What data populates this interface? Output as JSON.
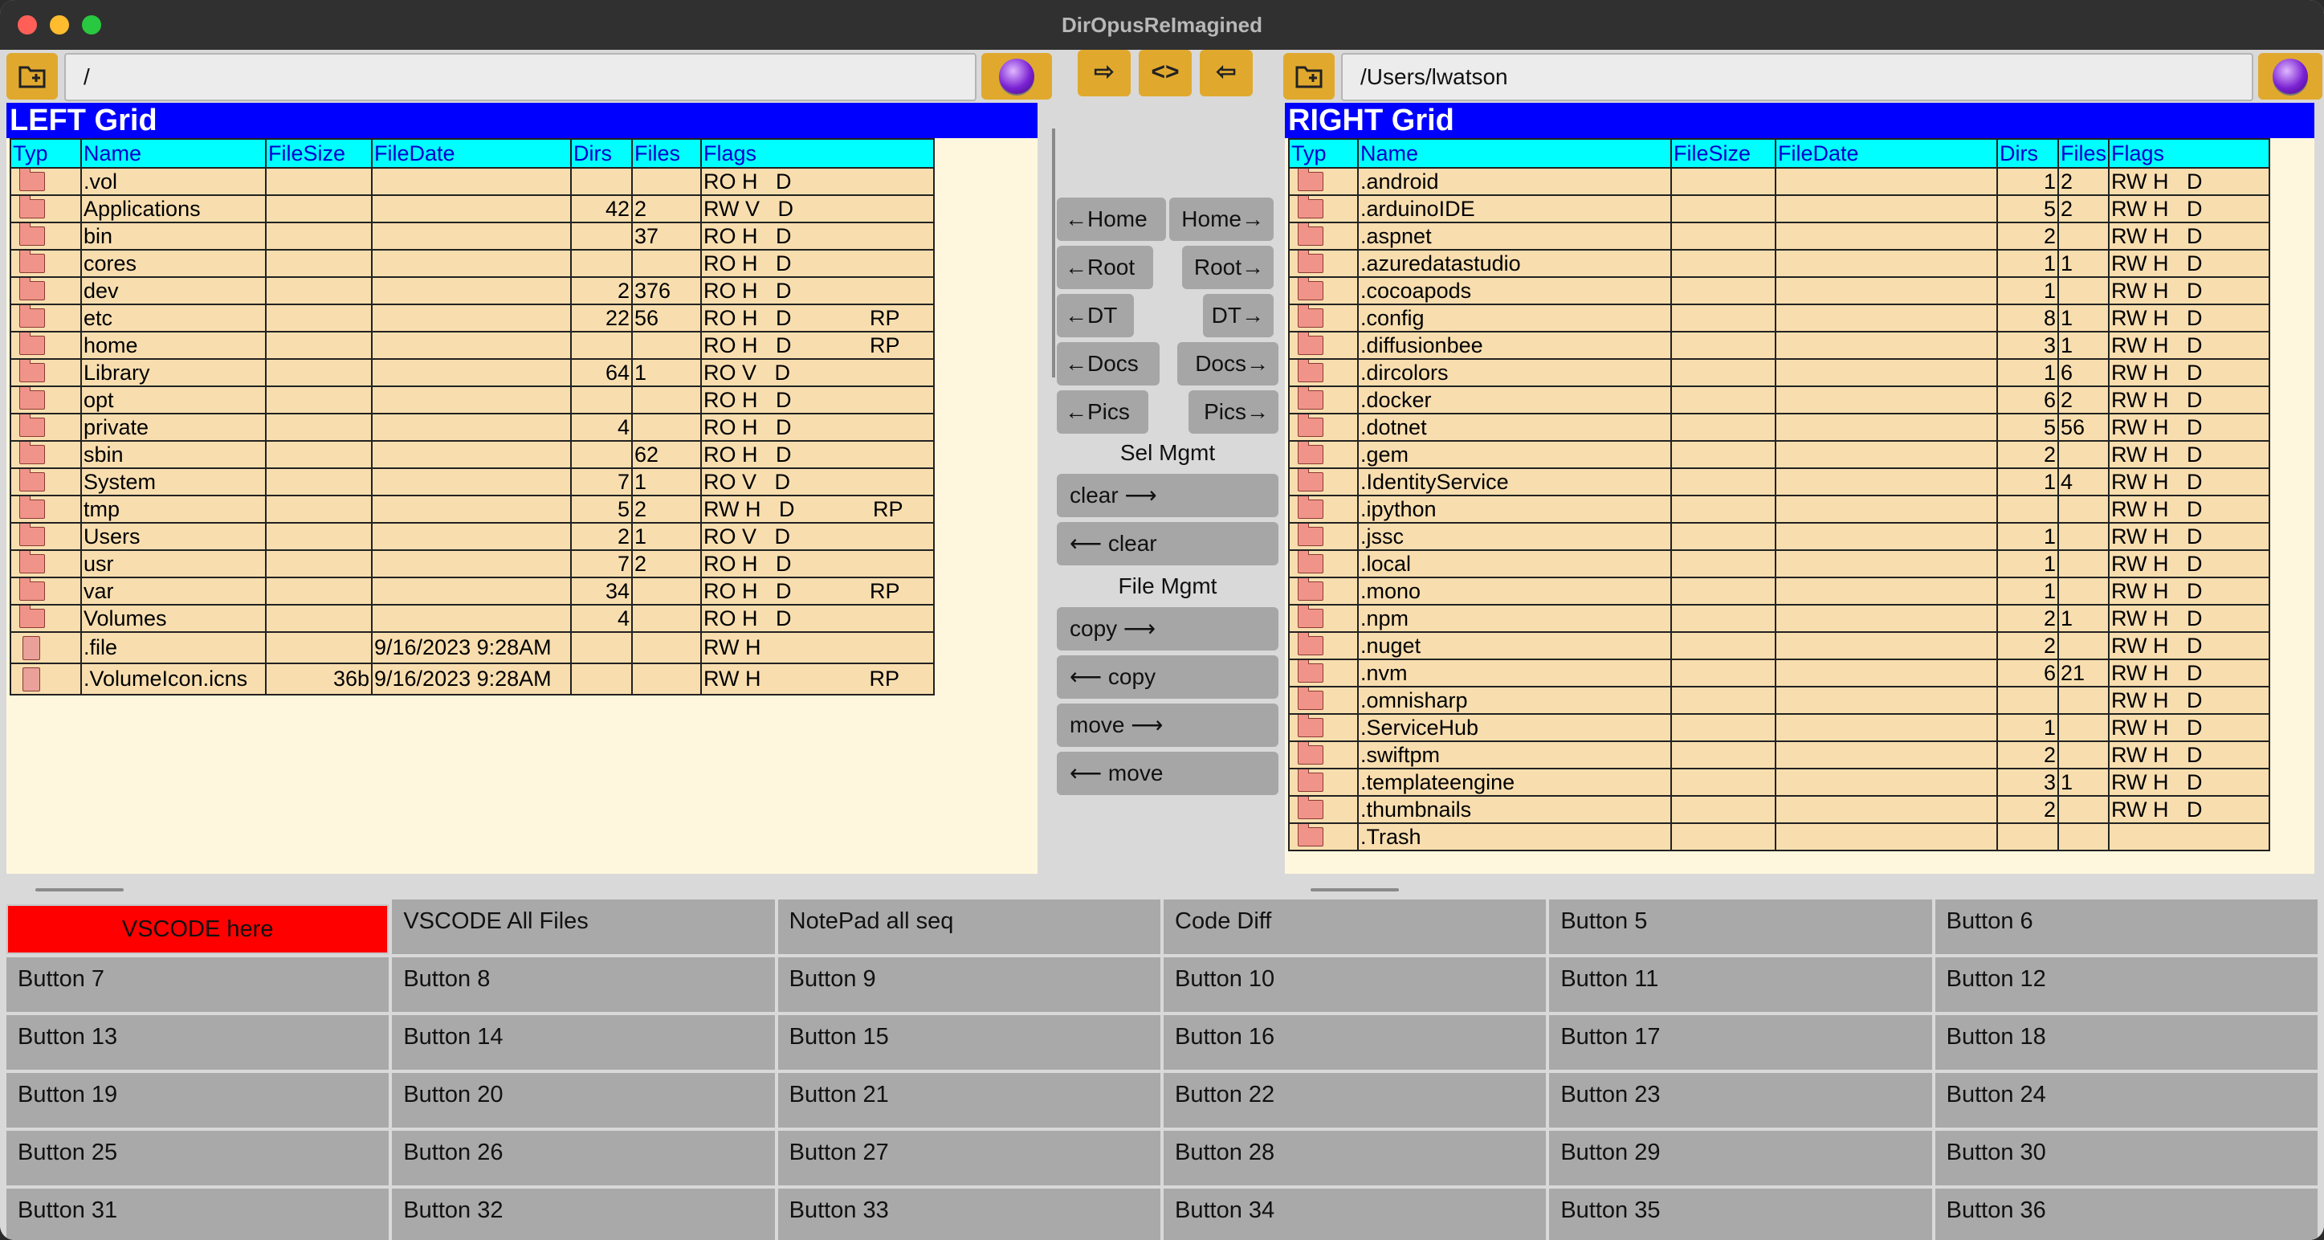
{
  "window": {
    "title": "DirOpusReImagined",
    "traffic_colors": [
      "#ff5f57",
      "#febc2e",
      "#28c840"
    ]
  },
  "left": {
    "path": "/",
    "grid_title": "LEFT Grid",
    "columns": [
      "Typ",
      "Name",
      "FileSize",
      "FileDate",
      "Dirs",
      "Files",
      "Flags"
    ],
    "rows": [
      {
        "type": "folder",
        "name": ".vol",
        "size": "",
        "date": "",
        "dirs": "",
        "files": "",
        "flags": "RO H   D"
      },
      {
        "type": "folder",
        "name": "Applications",
        "size": "",
        "date": "",
        "dirs": "42",
        "files": "2",
        "flags": "RW V   D"
      },
      {
        "type": "folder",
        "name": "bin",
        "size": "",
        "date": "",
        "dirs": "",
        "files": "37",
        "flags": "RO H   D"
      },
      {
        "type": "folder",
        "name": "cores",
        "size": "",
        "date": "",
        "dirs": "",
        "files": "",
        "flags": "RO H   D"
      },
      {
        "type": "folder",
        "name": "dev",
        "size": "",
        "date": "",
        "dirs": "2",
        "files": "376",
        "flags": "RO H   D"
      },
      {
        "type": "folder",
        "name": "etc",
        "size": "",
        "date": "",
        "dirs": "22",
        "files": "56",
        "flags": "RO H   D             RP"
      },
      {
        "type": "folder",
        "name": "home",
        "size": "",
        "date": "",
        "dirs": "",
        "files": "",
        "flags": "RO H   D             RP"
      },
      {
        "type": "folder",
        "name": "Library",
        "size": "",
        "date": "",
        "dirs": "64",
        "files": "1",
        "flags": "RO V   D"
      },
      {
        "type": "folder",
        "name": "opt",
        "size": "",
        "date": "",
        "dirs": "",
        "files": "",
        "flags": "RO H   D"
      },
      {
        "type": "folder",
        "name": "private",
        "size": "",
        "date": "",
        "dirs": "4",
        "files": "",
        "flags": "RO H   D"
      },
      {
        "type": "folder",
        "name": "sbin",
        "size": "",
        "date": "",
        "dirs": "",
        "files": "62",
        "flags": "RO H   D"
      },
      {
        "type": "folder",
        "name": "System",
        "size": "",
        "date": "",
        "dirs": "7",
        "files": "1",
        "flags": "RO V   D"
      },
      {
        "type": "folder",
        "name": "tmp",
        "size": "",
        "date": "",
        "dirs": "5",
        "files": "2",
        "flags": "RW H   D             RP"
      },
      {
        "type": "folder",
        "name": "Users",
        "size": "",
        "date": "",
        "dirs": "2",
        "files": "1",
        "flags": "RO V   D"
      },
      {
        "type": "folder",
        "name": "usr",
        "size": "",
        "date": "",
        "dirs": "7",
        "files": "2",
        "flags": "RO H   D"
      },
      {
        "type": "folder",
        "name": "var",
        "size": "",
        "date": "",
        "dirs": "34",
        "files": "",
        "flags": "RO H   D             RP"
      },
      {
        "type": "folder",
        "name": "Volumes",
        "size": "",
        "date": "",
        "dirs": "4",
        "files": "",
        "flags": "RO H   D"
      },
      {
        "type": "file",
        "name": ".file",
        "size": "",
        "date": "9/16/2023 9:28AM",
        "dirs": "",
        "files": "",
        "flags": "RW H"
      },
      {
        "type": "file",
        "name": ".VolumeIcon.icns",
        "size": "36b",
        "date": "9/16/2023 9:28AM",
        "dirs": "",
        "files": "",
        "flags": "RW H                  RP"
      }
    ]
  },
  "right": {
    "path": "/Users/lwatson",
    "grid_title": "RIGHT Grid",
    "columns": [
      "Typ",
      "Name",
      "FileSize",
      "FileDate",
      "Dirs",
      "Files",
      "Flags"
    ],
    "rows": [
      {
        "type": "folder",
        "name": ".android",
        "size": "",
        "date": "",
        "dirs": "1",
        "files": "2",
        "flags": "RW H   D"
      },
      {
        "type": "folder",
        "name": ".arduinoIDE",
        "size": "",
        "date": "",
        "dirs": "5",
        "files": "2",
        "flags": "RW H   D"
      },
      {
        "type": "folder",
        "name": ".aspnet",
        "size": "",
        "date": "",
        "dirs": "2",
        "files": "",
        "flags": "RW H   D"
      },
      {
        "type": "folder",
        "name": ".azuredatastudio",
        "size": "",
        "date": "",
        "dirs": "1",
        "files": "1",
        "flags": "RW H   D"
      },
      {
        "type": "folder",
        "name": ".cocoapods",
        "size": "",
        "date": "",
        "dirs": "1",
        "files": "",
        "flags": "RW H   D"
      },
      {
        "type": "folder",
        "name": ".config",
        "size": "",
        "date": "",
        "dirs": "8",
        "files": "1",
        "flags": "RW H   D"
      },
      {
        "type": "folder",
        "name": ".diffusionbee",
        "size": "",
        "date": "",
        "dirs": "3",
        "files": "1",
        "flags": "RW H   D"
      },
      {
        "type": "folder",
        "name": ".dircolors",
        "size": "",
        "date": "",
        "dirs": "1",
        "files": "6",
        "flags": "RW H   D"
      },
      {
        "type": "folder",
        "name": ".docker",
        "size": "",
        "date": "",
        "dirs": "6",
        "files": "2",
        "flags": "RW H   D"
      },
      {
        "type": "folder",
        "name": ".dotnet",
        "size": "",
        "date": "",
        "dirs": "5",
        "files": "56",
        "flags": "RW H   D"
      },
      {
        "type": "folder",
        "name": ".gem",
        "size": "",
        "date": "",
        "dirs": "2",
        "files": "",
        "flags": "RW H   D"
      },
      {
        "type": "folder",
        "name": ".IdentityService",
        "size": "",
        "date": "",
        "dirs": "1",
        "files": "4",
        "flags": "RW H   D"
      },
      {
        "type": "folder",
        "name": ".ipython",
        "size": "",
        "date": "",
        "dirs": "",
        "files": "",
        "flags": "RW H   D"
      },
      {
        "type": "folder",
        "name": ".jssc",
        "size": "",
        "date": "",
        "dirs": "1",
        "files": "",
        "flags": "RW H   D"
      },
      {
        "type": "folder",
        "name": ".local",
        "size": "",
        "date": "",
        "dirs": "1",
        "files": "",
        "flags": "RW H   D"
      },
      {
        "type": "folder",
        "name": ".mono",
        "size": "",
        "date": "",
        "dirs": "1",
        "files": "",
        "flags": "RW H   D"
      },
      {
        "type": "folder",
        "name": ".npm",
        "size": "",
        "date": "",
        "dirs": "2",
        "files": "1",
        "flags": "RW H   D"
      },
      {
        "type": "folder",
        "name": ".nuget",
        "size": "",
        "date": "",
        "dirs": "2",
        "files": "",
        "flags": "RW H   D"
      },
      {
        "type": "folder",
        "name": ".nvm",
        "size": "",
        "date": "",
        "dirs": "6",
        "files": "21",
        "flags": "RW H   D"
      },
      {
        "type": "folder",
        "name": ".omnisharp",
        "size": "",
        "date": "",
        "dirs": "",
        "files": "",
        "flags": "RW H   D"
      },
      {
        "type": "folder",
        "name": ".ServiceHub",
        "size": "",
        "date": "",
        "dirs": "1",
        "files": "",
        "flags": "RW H   D"
      },
      {
        "type": "folder",
        "name": ".swiftpm",
        "size": "",
        "date": "",
        "dirs": "2",
        "files": "",
        "flags": "RW H   D"
      },
      {
        "type": "folder",
        "name": ".templateengine",
        "size": "",
        "date": "",
        "dirs": "3",
        "files": "1",
        "flags": "RW H   D"
      },
      {
        "type": "folder",
        "name": ".thumbnails",
        "size": "",
        "date": "",
        "dirs": "2",
        "files": "",
        "flags": "RW H   D"
      },
      {
        "type": "folder",
        "name": ".Trash",
        "size": "",
        "date": "",
        "dirs": "",
        "files": "",
        "flags": ""
      }
    ]
  },
  "transfer_arrows": [
    "⇨",
    "<>",
    "⇦"
  ],
  "middle": {
    "nav": [
      {
        "left": "←Home",
        "right": "Home→"
      },
      {
        "left": "←Root",
        "right": "Root→"
      },
      {
        "left": "←DT",
        "right": "DT→"
      },
      {
        "left": "←Docs",
        "right": "Docs→"
      },
      {
        "left": "←Pics",
        "right": "Pics→"
      }
    ],
    "sel_label": "Sel Mgmt",
    "sel_buttons": [
      "clear  ⟶",
      "⟵  clear"
    ],
    "file_label": "File Mgmt",
    "file_buttons": [
      "copy  ⟶",
      "⟵  copy",
      "move  ⟶",
      "⟵  move"
    ]
  },
  "buttons": [
    "VSCODE here",
    "VSCODE All Files",
    "NotePad all seq",
    "Code Diff",
    "Button 5",
    "Button 6",
    "Button 7",
    "Button 8",
    "Button 9",
    "Button 10",
    "Button 11",
    "Button 12",
    "Button 13",
    "Button 14",
    "Button 15",
    "Button 16",
    "Button 17",
    "Button 18",
    "Button 19",
    "Button 20",
    "Button 21",
    "Button 22",
    "Button 23",
    "Button 24",
    "Button 25",
    "Button 26",
    "Button 27",
    "Button 28",
    "Button 29",
    "Button 30",
    "Button 31",
    "Button 32",
    "Button 33",
    "Button 34",
    "Button 35",
    "Button 36"
  ],
  "colors": {
    "highlight_button": "#ff0000",
    "grid_title_bg": "#0000ff",
    "header_bg": "#00ffff",
    "row_bg": "#f8deaf",
    "folder_buttons": "#e0a92e"
  }
}
